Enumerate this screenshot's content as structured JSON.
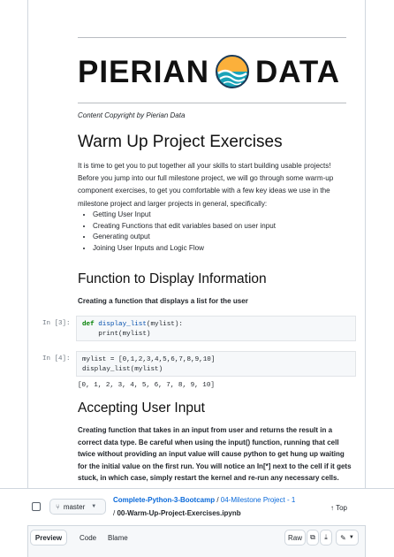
{
  "logo": {
    "left_word": "PIERIAN",
    "right_word": "DATA"
  },
  "notebook": {
    "copyright": "Content Copyright by Pierian Data",
    "warmup_title": "Warm Up Project Exercises",
    "warmup_paragraph": "It is time to get you to put together all your skills to start building usable projects! Before you jump into our full milestone project, we will go through some warm-up component exercises, to get you comfortable with a few key ideas we use in the milestone project and larger projects in general, specifically:",
    "bullets": [
      "Getting User Input",
      "Creating Functions that edit variables based on user input",
      "Generating output",
      "Joining User Inputs and Logic Flow"
    ],
    "function_title": "Function to Display Information",
    "function_subtitle": "Creating a function that displays a list for the user",
    "cell3": {
      "prompt": "In [3]:",
      "line1_kw": "def",
      "line1_fn": "display_list",
      "line1_rest": "(mylist):",
      "line2": "    print(mylist)"
    },
    "cell4": {
      "prompt": "In [4]:",
      "line1": "mylist = [0,1,2,3,4,5,6,7,8,9,10]",
      "line2": "display_list(mylist)"
    },
    "output4": "[0, 1, 2, 3, 4, 5, 6, 7, 8, 9, 10]",
    "accept_title": "Accepting User Input",
    "accept_paragraph": "Creating function that takes in an input from user and returns the result in a correct data type. Be careful when using the input() function, running that cell twice without providing an input value will cause python to get hung up waiting for the initial value on the first run. You will notice an In[*] next to the cell if it gets stuck, in which case, simply restart the kernel and re-run any necessary cells."
  },
  "stickybar": {
    "branch": "master",
    "repo": "Complete-Python-3-Bootcamp",
    "sep1": " / ",
    "folder": "04-Milestone Project - 1",
    "sep2": "/ ",
    "file": "00-Warm-Up-Project-Exercises.ipynb",
    "top": "Top"
  },
  "tabs": {
    "preview": "Preview",
    "code": "Code",
    "blame": "Blame",
    "raw": "Raw"
  }
}
